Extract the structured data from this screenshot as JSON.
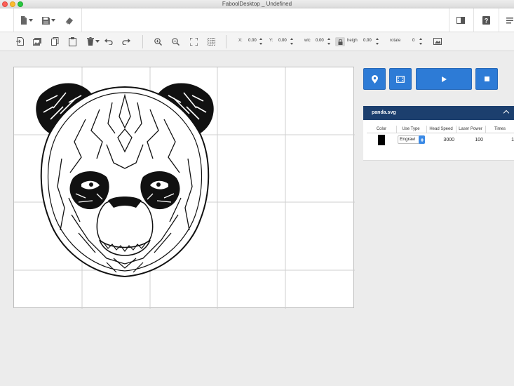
{
  "window": {
    "title": "FaboolDesktop _ Undefined"
  },
  "topbar": {
    "left_icons": [
      "new-file-icon",
      "save-icon",
      "eraser-icon"
    ],
    "right_icons": [
      "layout-icon",
      "help-icon",
      "menu-icon"
    ]
  },
  "toolbar": {
    "fields": {
      "x_label": "X:",
      "x_value": "0.00",
      "y_label": "Y:",
      "y_value": "0.00",
      "w_label": "wic",
      "w_value": "0.00",
      "h_label": "heigh",
      "h_value": "0.00",
      "rotate_label": "rotate",
      "rotate_value": "0"
    }
  },
  "layer": {
    "filename": "panda.svg",
    "columns": [
      "Color",
      "Use Type",
      "Head Speed",
      "Laser Power",
      "Times"
    ],
    "row": {
      "color": "#000000",
      "use_type": "Engravi",
      "head_speed": "3000",
      "laser_power": "100",
      "times": "1"
    }
  },
  "colors": {
    "accent": "#2d7bd6",
    "panel_header": "#1c3f6e"
  }
}
